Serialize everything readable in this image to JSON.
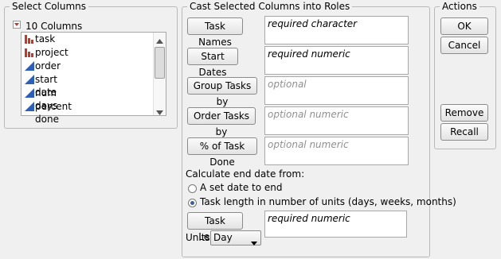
{
  "select_columns": {
    "legend": "Select Columns",
    "count_label": "10 Columns",
    "items": [
      {
        "label": "task",
        "type": "nominal"
      },
      {
        "label": "project",
        "type": "nominal"
      },
      {
        "label": "order",
        "type": "continuous"
      },
      {
        "label": "start date",
        "type": "continuous"
      },
      {
        "label": "num days",
        "type": "continuous"
      },
      {
        "label": "percent done",
        "type": "continuous"
      }
    ]
  },
  "cast": {
    "legend": "Cast Selected Columns into Roles",
    "roles": [
      {
        "button": "Task Names",
        "field": "required character",
        "kind": "req"
      },
      {
        "button": "Start Dates",
        "field": "required numeric",
        "kind": "req"
      },
      {
        "button": "Group Tasks by",
        "field": "optional",
        "kind": "opt"
      },
      {
        "button": "Order Tasks by",
        "field": "optional numeric",
        "kind": "opt"
      },
      {
        "button": "% of Task Done",
        "field": "optional numeric",
        "kind": "opt"
      }
    ],
    "calc_label": "Calculate end date from:",
    "radio_1": "A set date to end",
    "radio_2": "Task length in number of units (days, weeks, months)",
    "task_length_button": "Task Length",
    "task_length_field": "required numeric",
    "units_label": "Units:",
    "units_value": "Day"
  },
  "actions": {
    "legend": "Actions",
    "ok": "OK",
    "cancel": "Cancel",
    "remove": "Remove",
    "recall": "Recall"
  },
  "colors": {
    "nominal_icon": "#c0392b",
    "continuous_icon": "#2e5fb8"
  }
}
